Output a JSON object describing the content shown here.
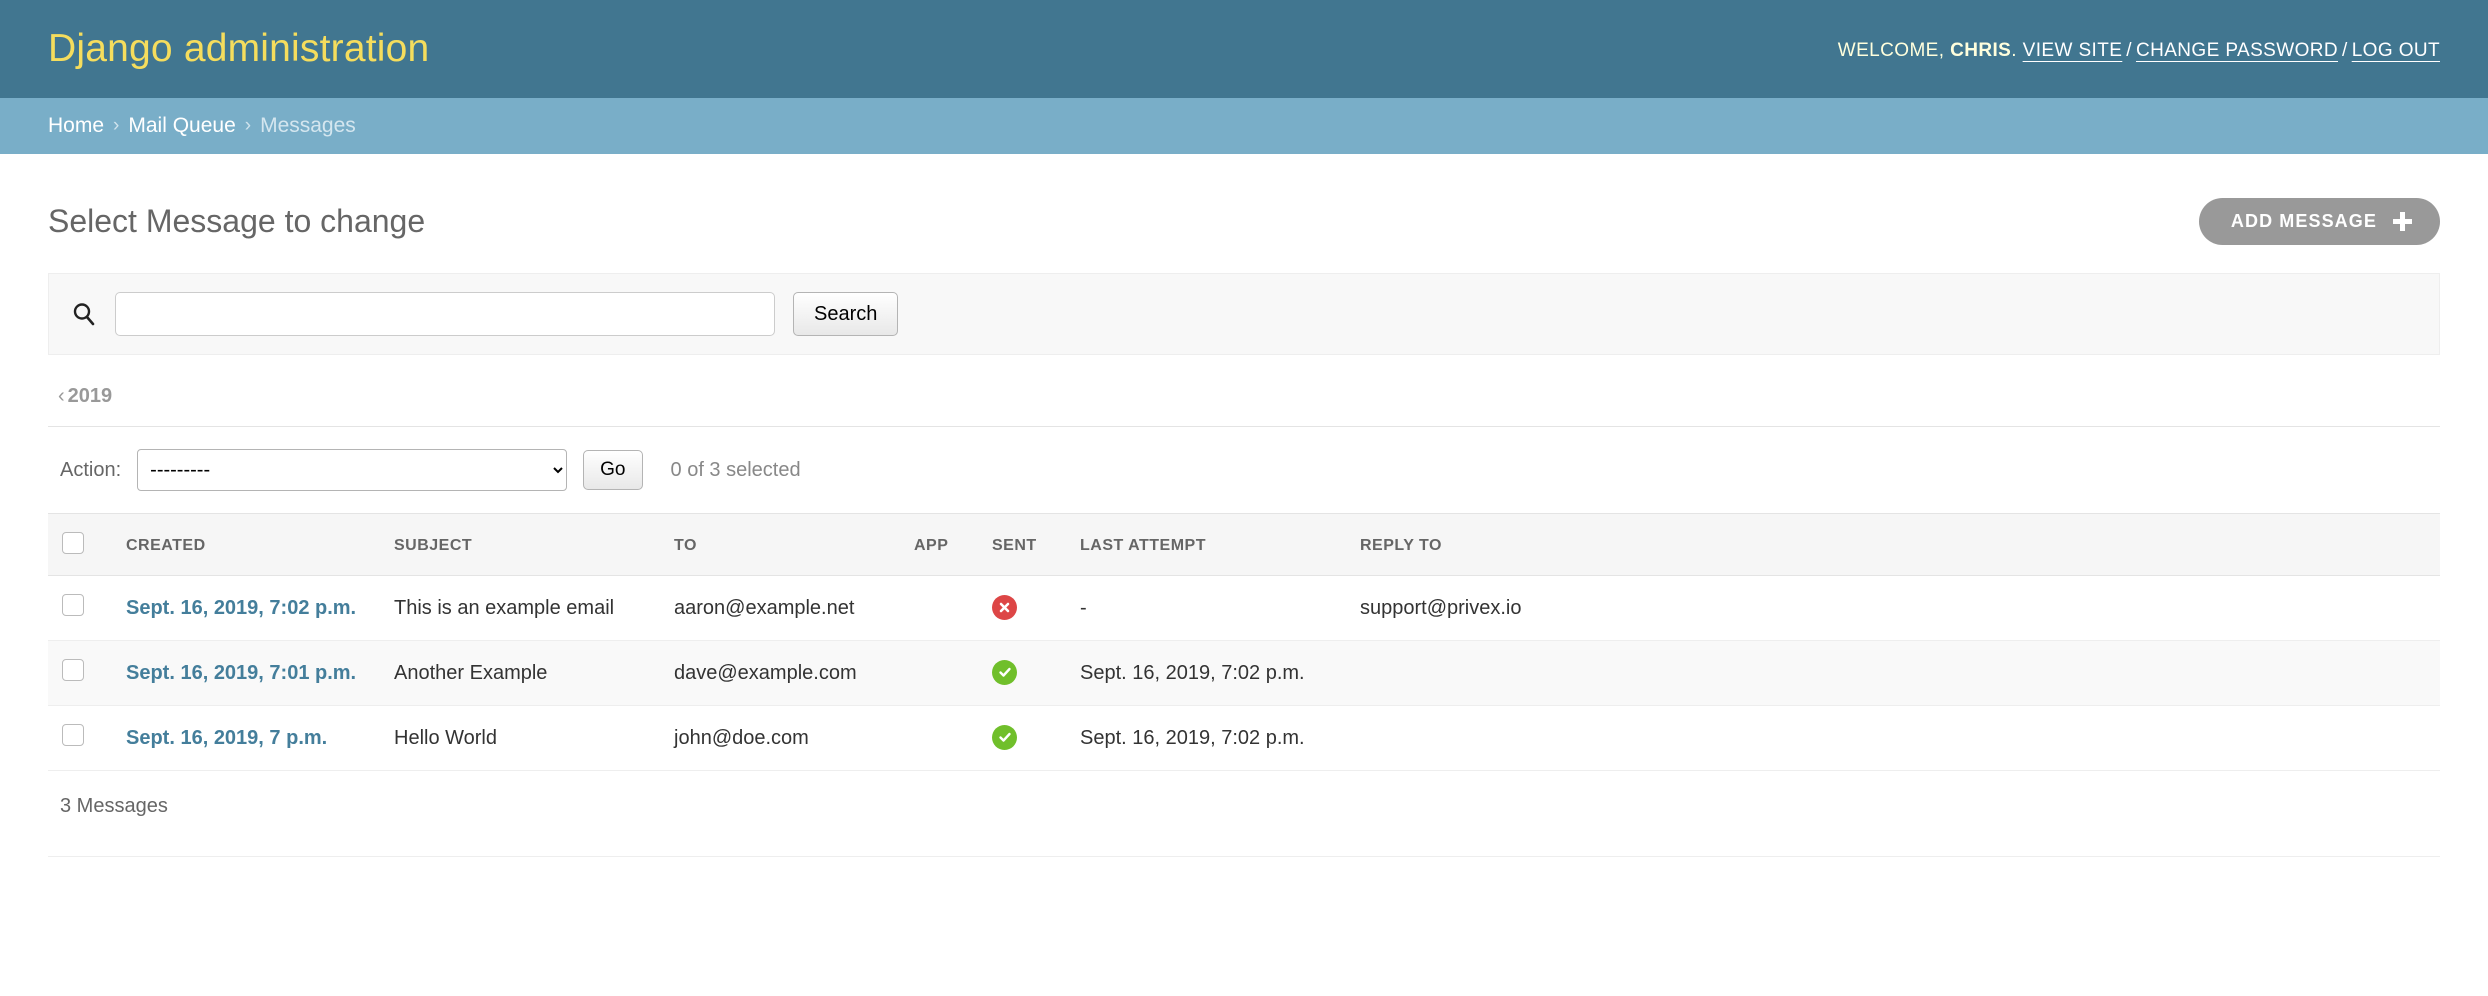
{
  "header": {
    "site_name": "Django administration",
    "welcome_prefix": "WELCOME, ",
    "username": "CHRIS",
    "welcome_suffix": ".",
    "links": [
      {
        "label": "VIEW SITE",
        "name": "view-site-link"
      },
      {
        "label": "CHANGE PASSWORD",
        "name": "change-password-link"
      },
      {
        "label": "LOG OUT",
        "name": "log-out-link"
      }
    ],
    "separator": "/",
    "colors": {
      "bar": "#417690",
      "title": "#f5dd5d",
      "link": "#ffffff"
    }
  },
  "breadcrumbs": {
    "items": [
      {
        "label": "Home",
        "current": false
      },
      {
        "label": "Mail Queue",
        "current": false
      },
      {
        "label": "Messages",
        "current": true
      }
    ],
    "separator": "›",
    "background": "#79aec8"
  },
  "page": {
    "title": "Select Message to change",
    "add_button_label": "ADD MESSAGE",
    "add_button_icon": "plus-icon"
  },
  "search": {
    "icon": "search-icon",
    "value": "",
    "placeholder": "",
    "submit_label": "Search"
  },
  "date_hierarchy": {
    "back_chevron": "‹",
    "label": "2019"
  },
  "actions": {
    "label": "Action:",
    "selected_option": "---------",
    "options": [
      "---------"
    ],
    "go_label": "Go",
    "counter": "0 of 3 selected"
  },
  "table": {
    "select_all_name": "select-all-checkbox",
    "columns": [
      "CREATED",
      "SUBJECT",
      "TO",
      "APP",
      "SENT",
      "LAST ATTEMPT",
      "REPLY TO"
    ],
    "rows": [
      {
        "created": "Sept. 16, 2019, 7:02 p.m.",
        "subject": "This is an example email",
        "to": "aaron@example.net",
        "app": "",
        "sent": "no",
        "sent_icon": "cross-circle-icon",
        "last_attempt": "-",
        "reply_to": "support@privex.io"
      },
      {
        "created": "Sept. 16, 2019, 7:01 p.m.",
        "subject": "Another Example",
        "to": "dave@example.com",
        "app": "",
        "sent": "yes",
        "sent_icon": "check-circle-icon",
        "last_attempt": "Sept. 16, 2019, 7:02 p.m.",
        "reply_to": ""
      },
      {
        "created": "Sept. 16, 2019, 7 p.m.",
        "subject": "Hello World",
        "to": "john@doe.com",
        "app": "",
        "sent": "yes",
        "sent_icon": "check-circle-icon",
        "last_attempt": "Sept. 16, 2019, 7:02 p.m.",
        "reply_to": ""
      }
    ]
  },
  "paginator": {
    "summary": "3 Messages"
  },
  "colors": {
    "accent": "#417690",
    "link": "#447e9b",
    "success": "#70bf2b",
    "error": "#dd4646",
    "button": "#999999"
  }
}
